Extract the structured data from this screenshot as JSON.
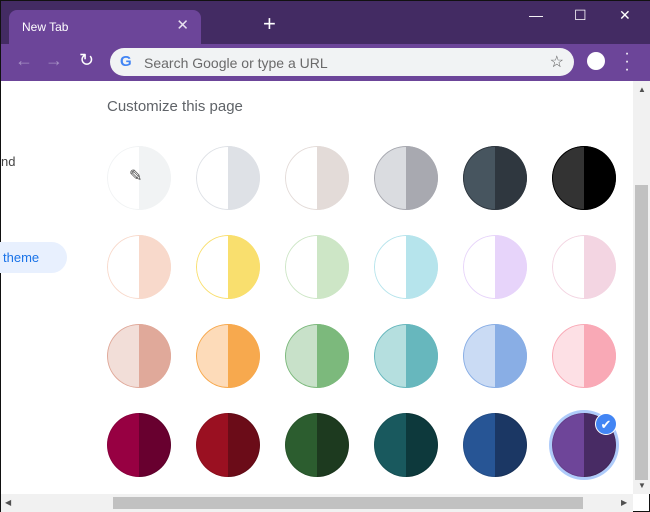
{
  "browser": {
    "tab_title": "New Tab",
    "omnibox_placeholder": "Search Google or type a URL",
    "google_g": "G"
  },
  "sidebar": {
    "partial_item": "nd",
    "selected_item": "theme"
  },
  "main": {
    "heading": "Customize this page"
  },
  "themes": [
    [
      {
        "name": "custom-color-picker",
        "l": "#ffffff",
        "r": "#f1f3f4",
        "picker": true
      },
      {
        "name": "light-grey",
        "l": "#ffffff",
        "r": "#dee1e6"
      },
      {
        "name": "warm-grey",
        "l": "#ffffff",
        "r": "#e3dbd8"
      },
      {
        "name": "cool-grey",
        "l": "#dadce0",
        "r": "#a8a9b0"
      },
      {
        "name": "dark-blue-grey",
        "l": "#47555f",
        "r": "#2f373f"
      },
      {
        "name": "black",
        "l": "#333333",
        "r": "#000000"
      }
    ],
    [
      {
        "name": "beige-white",
        "l": "#ffffff",
        "r": "#f8d9cb"
      },
      {
        "name": "yellow-white",
        "l": "#ffffff",
        "r": "#f9df6e"
      },
      {
        "name": "green-white",
        "l": "#ffffff",
        "r": "#cde6c6"
      },
      {
        "name": "light-teal-white",
        "l": "#ffffff",
        "r": "#b6e4ec"
      },
      {
        "name": "light-purple-white",
        "l": "#ffffff",
        "r": "#e7d4fa"
      },
      {
        "name": "pink-white",
        "l": "#ffffff",
        "r": "#f3d5e2"
      }
    ],
    [
      {
        "name": "beige",
        "l": "#f2ded8",
        "r": "#e0a99a"
      },
      {
        "name": "orange",
        "l": "#fddbb9",
        "r": "#f7a94e"
      },
      {
        "name": "light-green",
        "l": "#c8e1c9",
        "r": "#7cb97c"
      },
      {
        "name": "light-teal",
        "l": "#b5dfdf",
        "r": "#67b7bd"
      },
      {
        "name": "light-blue",
        "l": "#cadbf4",
        "r": "#89aee5"
      },
      {
        "name": "pink",
        "l": "#fde0e5",
        "r": "#f9a9b6"
      }
    ],
    [
      {
        "name": "dark-pink-red",
        "l": "#970042",
        "r": "#68002f"
      },
      {
        "name": "dark-red-orange",
        "l": "#9a1021",
        "r": "#6b0c18"
      },
      {
        "name": "dark-green",
        "l": "#2c5d2f",
        "r": "#1d3a1f"
      },
      {
        "name": "dark-teal",
        "l": "#19595e",
        "r": "#0d393c"
      },
      {
        "name": "dark-blue",
        "l": "#275595",
        "r": "#1b3764"
      },
      {
        "name": "purple",
        "l": "#6e4599",
        "r": "#482b64",
        "selected": true
      }
    ]
  ]
}
